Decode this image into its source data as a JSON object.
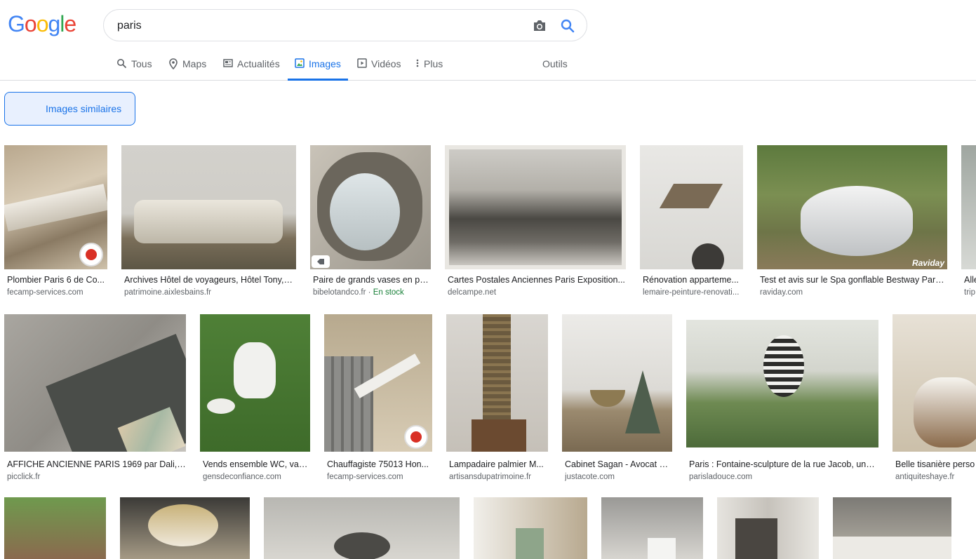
{
  "logo": {
    "letters": [
      "G",
      "o",
      "o",
      "g",
      "l",
      "e"
    ],
    "colors": [
      "#4285f4",
      "#ea4335",
      "#fbbc05",
      "#4285f4",
      "#34a853",
      "#ea4335"
    ]
  },
  "search": {
    "value": "paris",
    "camera_icon": "camera-icon",
    "search_icon": "search-icon"
  },
  "tabs": [
    {
      "label": "Tous",
      "icon": "search-icon"
    },
    {
      "label": "Maps",
      "icon": "map-pin-icon"
    },
    {
      "label": "Actualités",
      "icon": "news-icon"
    },
    {
      "label": "Images",
      "icon": "image-icon",
      "active": true
    },
    {
      "label": "Vidéos",
      "icon": "play-icon"
    },
    {
      "label": "Plus",
      "icon": "more-vert-icon"
    },
    {
      "label": "Outils"
    }
  ],
  "similar_button": {
    "label": "Images similaires"
  },
  "results": {
    "row1": [
      {
        "caption": "Plombier Paris 6 de Co...",
        "source": "fecamp-services.com"
      },
      {
        "caption": "Archives Hôtel de voyageurs, Hôtel Tony, ...",
        "source": "patrimoine.aixlesbains.fr"
      },
      {
        "caption": "Paire de grands vases en po...",
        "source": "bibelotandco.fr",
        "stock": "En stock"
      },
      {
        "caption": "Cartes Postales Anciennes Paris Exposition...",
        "source": "delcampe.net"
      },
      {
        "caption": "Rénovation apparteme...",
        "source": "lemaire-peinture-renovati..."
      },
      {
        "caption": "Test et avis sur le Spa gonflable Bestway Pari...",
        "source": "raviday.com",
        "overlay": "Raviday"
      },
      {
        "caption": "Alle",
        "source": "trip"
      }
    ],
    "row2": [
      {
        "caption": "AFFICHE ANCIENNE PARIS 1969 par Dali, to...",
        "source": "picclick.fr"
      },
      {
        "caption": "Vends ensemble WC, vas...",
        "source": "gensdeconfiance.com"
      },
      {
        "caption": "Chauffagiste 75013 Hon...",
        "source": "fecamp-services.com"
      },
      {
        "caption": "Lampadaire palmier M...",
        "source": "artisansdupatrimoine.fr"
      },
      {
        "caption": "Cabinet Sagan - Avocat D...",
        "source": "justacote.com"
      },
      {
        "caption": "Paris : Fontaine-sculpture de la rue Jacob, une ...",
        "source": "parisladouce.com"
      },
      {
        "caption": "Belle tisanière perso",
        "source": "antiquiteshaye.fr"
      }
    ]
  },
  "colors": {
    "accent": "#1a73e8",
    "muted": "#5f6368",
    "stock": "#188038"
  }
}
